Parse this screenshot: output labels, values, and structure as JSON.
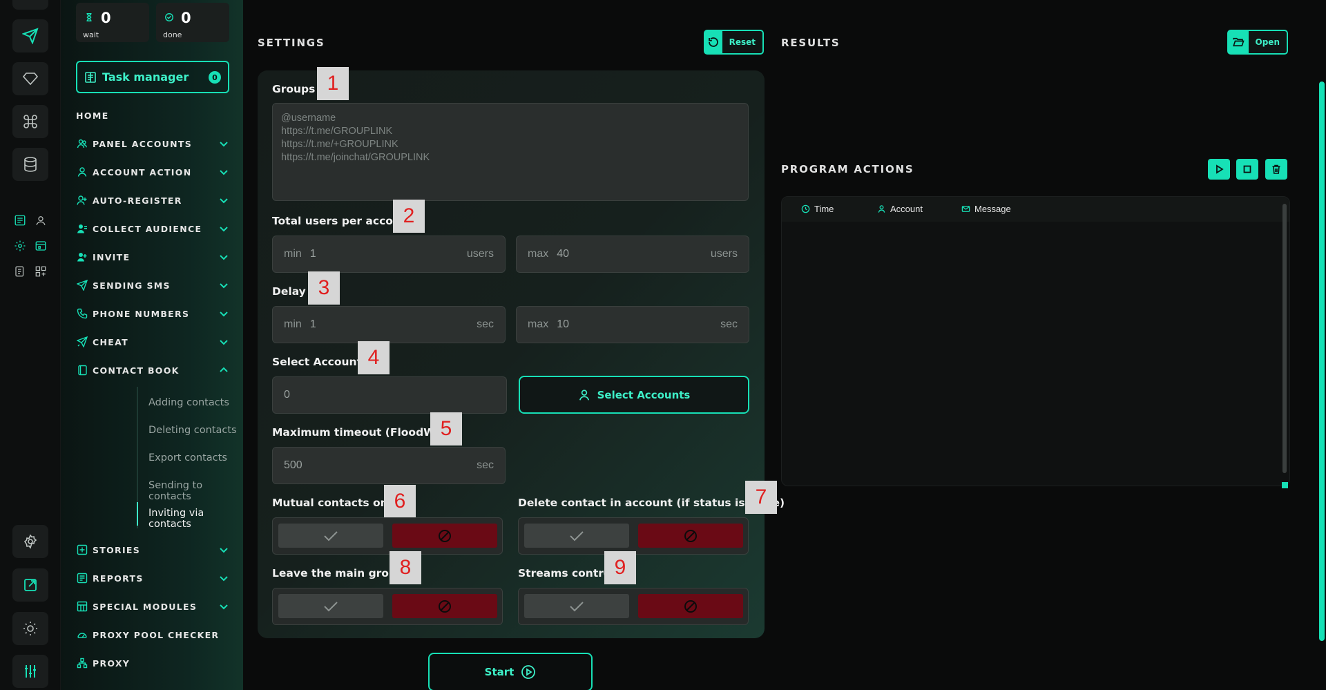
{
  "counters": [
    {
      "value": "0",
      "label": "wait",
      "icon": "hourglass-icon"
    },
    {
      "value": "0",
      "label": "done",
      "icon": "check-circle-icon"
    }
  ],
  "task_manager": {
    "label": "Task manager",
    "badge": "0"
  },
  "nav": {
    "home": "HOME",
    "items": [
      {
        "label": "PANEL ACCOUNTS",
        "icon": "users-icon"
      },
      {
        "label": "ACCOUNT ACTION",
        "icon": "user-icon"
      },
      {
        "label": "AUTO-REGISTER",
        "icon": "user-plus-icon"
      },
      {
        "label": "COLLECT AUDIENCE",
        "icon": "user-list-icon"
      },
      {
        "label": "INVITE",
        "icon": "user-add-icon"
      },
      {
        "label": "SENDING SMS",
        "icon": "send-icon"
      },
      {
        "label": "PHONE NUMBERS",
        "icon": "phone-icon"
      },
      {
        "label": "CHEAT",
        "icon": "cheat-icon"
      },
      {
        "label": "CONTACT BOOK",
        "icon": "book-icon"
      },
      {
        "label": "STORIES",
        "icon": "plus-square-icon"
      },
      {
        "label": "REPORTS",
        "icon": "report-icon"
      },
      {
        "label": "SPECIAL MODULES",
        "icon": "modules-icon"
      },
      {
        "label": "PROXY POOL CHECKER",
        "icon": "gauge-icon"
      },
      {
        "label": "PROXY",
        "icon": "network-icon"
      }
    ],
    "contact_book_sub": [
      "Adding contacts",
      "Deleting contacts",
      "Export contacts",
      "Sending to contacts",
      "Inviting via contacts"
    ]
  },
  "settings": {
    "title": "SETTINGS",
    "reset": "Reset",
    "groups_label": "Groups",
    "groups_placeholder": "@username\nhttps://t.me/GROUPLINK\nhttps://t.me/+GROUPLINK\nhttps://t.me/joinchat/GROUPLINK",
    "total_users_label": "Total users per account",
    "users_min": {
      "prefix": "min",
      "value": "1",
      "suffix": "users"
    },
    "users_max": {
      "prefix": "max",
      "value": "40",
      "suffix": "users"
    },
    "delay_label": "Delay",
    "delay_min": {
      "prefix": "min",
      "value": "1",
      "suffix": "sec"
    },
    "delay_max": {
      "prefix": "max",
      "value": "10",
      "suffix": "sec"
    },
    "select_accounts_label": "Select Accounts",
    "accounts_value": "0",
    "select_accounts_button": "Select Accounts",
    "timeout_label": "Maximum timeout (FloodWait)",
    "timeout": {
      "value": "500",
      "suffix": "sec"
    },
    "mutual_label": "Mutual contacts only",
    "delete_label": "Delete contact in account (if status is Done)",
    "leave_label": "Leave the main group",
    "streams_label": "Streams control",
    "start": "Start"
  },
  "tags": [
    "1",
    "2",
    "3",
    "4",
    "5",
    "6",
    "7",
    "8",
    "9"
  ],
  "results": {
    "title": "RESULTS",
    "open": "Open"
  },
  "program_actions": {
    "title": "PROGRAM ACTIONS",
    "columns": [
      "Time",
      "Account",
      "Message"
    ]
  },
  "colors": {
    "accent": "#17e0b6",
    "danger": "#6a0a15"
  }
}
